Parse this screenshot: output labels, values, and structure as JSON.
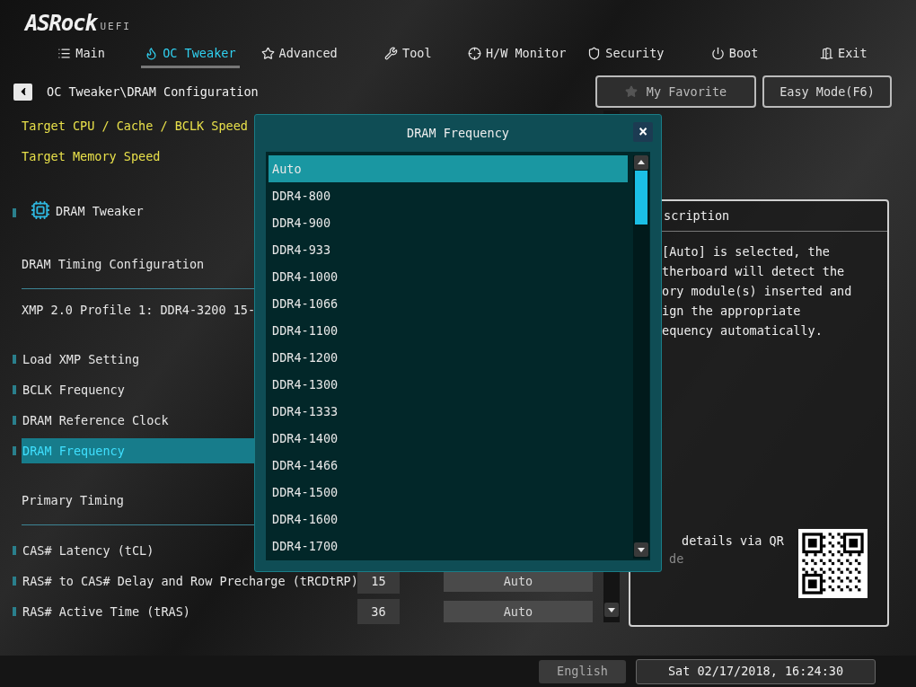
{
  "logo": {
    "brand": "ASRock",
    "suffix": "UEFI"
  },
  "tabs": [
    {
      "label": "Main",
      "selected": false
    },
    {
      "label": "OC Tweaker",
      "selected": true
    },
    {
      "label": "Advanced",
      "selected": false
    },
    {
      "label": "Tool",
      "selected": false
    },
    {
      "label": "H/W Monitor",
      "selected": false
    },
    {
      "label": "Security",
      "selected": false
    },
    {
      "label": "Boot",
      "selected": false
    },
    {
      "label": "Exit",
      "selected": false
    }
  ],
  "breadcrumb": "OC Tweaker\\DRAM Configuration",
  "top_buttons": [
    "My Favorite",
    "Easy Mode(F6)"
  ],
  "settings": [
    {
      "kind": "info",
      "label": "Target CPU / Cache / BCLK Speed"
    },
    {
      "kind": "info",
      "label": "Target Memory Speed"
    },
    {
      "kind": "group",
      "label": "DRAM Tweaker"
    },
    {
      "kind": "heading",
      "label": "DRAM Timing Configuration"
    },
    {
      "kind": "text",
      "label": "XMP 2.0 Profile 1: DDR4-3200 15-"
    },
    {
      "kind": "setting",
      "label": "Load XMP Setting",
      "selected": false
    },
    {
      "kind": "setting",
      "label": "BCLK Frequency",
      "selected": false
    },
    {
      "kind": "setting",
      "label": "DRAM Reference Clock",
      "selected": false
    },
    {
      "kind": "setting",
      "label": "DRAM Frequency",
      "selected": true
    },
    {
      "kind": "heading",
      "label": "Primary Timing"
    },
    {
      "kind": "setting",
      "label": "CAS# Latency (tCL)",
      "selected": false
    },
    {
      "kind": "setting",
      "label": "RAS# to CAS# Delay and Row Precharge (tRCDtRP)",
      "value": "15",
      "option": "Auto",
      "selected": false
    },
    {
      "kind": "setting",
      "label": "RAS# Active Time (tRAS)",
      "value": "36",
      "option": "Auto",
      "selected": false
    }
  ],
  "description": {
    "title": "scription",
    "text": "[Auto] is selected, the\ntherboard will detect the\nory module(s) inserted and\nign the appropriate\nequency automatically.",
    "qr_text": "details via QR",
    "qr_text_2": "de"
  },
  "dialog": {
    "title": "DRAM Frequency",
    "close": "×",
    "options": [
      {
        "label": "Auto",
        "selected": true
      },
      {
        "label": "DDR4-800",
        "selected": false
      },
      {
        "label": "DDR4-900",
        "selected": false
      },
      {
        "label": "DDR4-933",
        "selected": false
      },
      {
        "label": "DDR4-1000",
        "selected": false
      },
      {
        "label": "DDR4-1066",
        "selected": false
      },
      {
        "label": "DDR4-1100",
        "selected": false
      },
      {
        "label": "DDR4-1200",
        "selected": false
      },
      {
        "label": "DDR4-1300",
        "selected": false
      },
      {
        "label": "DDR4-1333",
        "selected": false
      },
      {
        "label": "DDR4-1400",
        "selected": false
      },
      {
        "label": "DDR4-1466",
        "selected": false
      },
      {
        "label": "DDR4-1500",
        "selected": false
      },
      {
        "label": "DDR4-1600",
        "selected": false
      },
      {
        "label": "DDR4-1700",
        "selected": false
      }
    ]
  },
  "status_bar": {
    "language": "English",
    "datetime": "Sat 02/17/2018, 16:24:30"
  }
}
